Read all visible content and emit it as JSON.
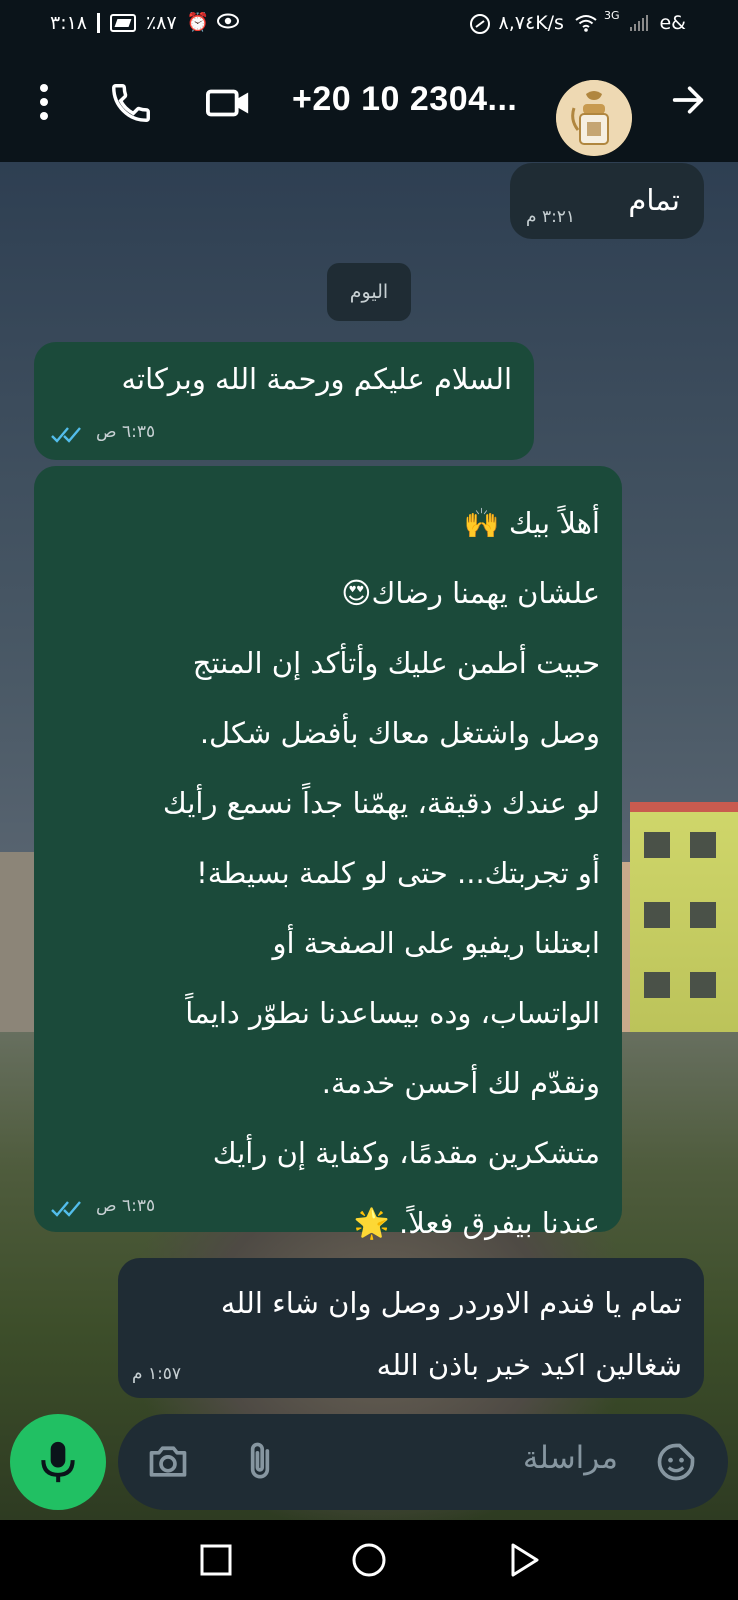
{
  "status_bar": {
    "time": "٣:١٨",
    "battery": "٪٨٧",
    "net_speed": "٨,٧٤K/s",
    "network_type": "3G",
    "carrier": "e&"
  },
  "header": {
    "contact_name": "+20 10 2304...",
    "icons": [
      "menu-icon",
      "phone-icon",
      "video-call-icon",
      "avatar",
      "back-arrow-icon"
    ]
  },
  "chat": {
    "messages": [
      {
        "direction": "incoming",
        "text": "تمام",
        "time": "٣:٢١ م"
      },
      {
        "type": "date",
        "label": "اليوم"
      },
      {
        "direction": "outgoing",
        "text": "السلام عليكم ورحمة الله وبركاته",
        "time": "٦:٣٥ ص",
        "status": "read"
      },
      {
        "direction": "outgoing",
        "lines": [
          "أهلاً بيك 🙌",
          "علشان يهمنا رضاك😍",
          "حبيت أطمن عليك وأتأكد إن المنتج",
          "وصل واشتغل معاك بأفضل شكل.",
          "لو عندك دقيقة، يهمّنا جداً نسمع رأيك",
          "أو تجربتك... حتى لو كلمة بسيطة!",
          "ابعتلنا ريفيو على الصفحة أو",
          "الواتساب، وده بيساعدنا نطوّر دايماً",
          "ونقدّم لك أحسن خدمة.",
          "متشكرين مقدمًا، وكفاية إن رأيك",
          "عندنا بيفرق فعلاً. 🌟"
        ],
        "time": "٦:٣٥ ص",
        "status": "read"
      },
      {
        "direction": "incoming",
        "lines": [
          "تمام يا فندم الاوردر وصل وان شاء الله",
          "شغالين اكيد خير باذن الله"
        ],
        "time": "١:٥٧ م"
      }
    ]
  },
  "composer": {
    "placeholder": "مراسلة",
    "icons": [
      "sticker-icon",
      "attach-icon",
      "camera-icon",
      "mic-icon"
    ]
  },
  "colors": {
    "app_bg": "#0b141a",
    "incoming_bubble": "#1f2c34",
    "outgoing_bubble": "#1b4a3a",
    "read_ticks": "#53bdeb",
    "mic_button": "#21c063"
  }
}
